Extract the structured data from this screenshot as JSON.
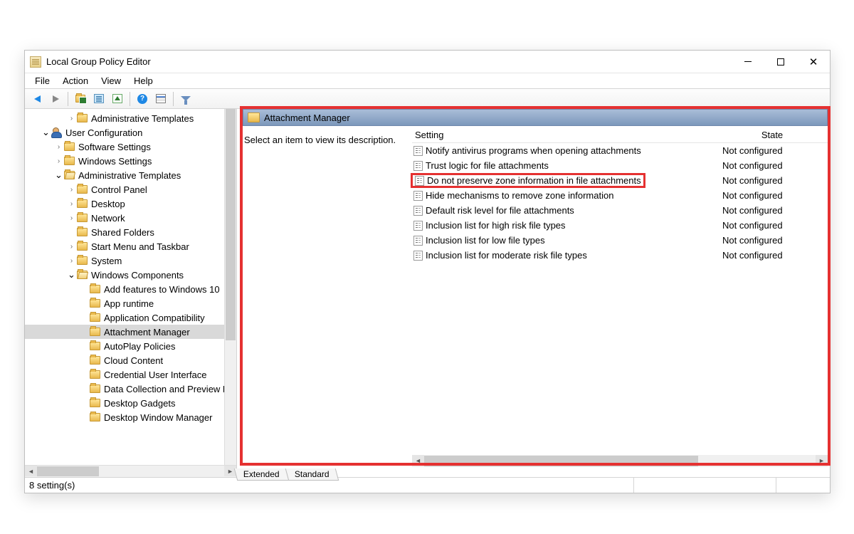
{
  "window": {
    "title": "Local Group Policy Editor"
  },
  "menu": {
    "file": "File",
    "action": "Action",
    "view": "View",
    "help": "Help"
  },
  "tree": {
    "items": [
      {
        "indent": 2,
        "expander": ">",
        "icon": "folder",
        "label": "Administrative Templates"
      },
      {
        "indent": 0,
        "expander": "v",
        "icon": "user",
        "label": "User Configuration"
      },
      {
        "indent": 1,
        "expander": ">",
        "icon": "folder",
        "label": "Software Settings"
      },
      {
        "indent": 1,
        "expander": ">",
        "icon": "folder",
        "label": "Windows Settings"
      },
      {
        "indent": 1,
        "expander": "v",
        "icon": "folder-open",
        "label": "Administrative Templates"
      },
      {
        "indent": 2,
        "expander": ">",
        "icon": "folder",
        "label": "Control Panel"
      },
      {
        "indent": 2,
        "expander": ">",
        "icon": "folder",
        "label": "Desktop"
      },
      {
        "indent": 2,
        "expander": ">",
        "icon": "folder",
        "label": "Network"
      },
      {
        "indent": 2,
        "expander": "",
        "icon": "folder",
        "label": "Shared Folders"
      },
      {
        "indent": 2,
        "expander": ">",
        "icon": "folder",
        "label": "Start Menu and Taskbar"
      },
      {
        "indent": 2,
        "expander": ">",
        "icon": "folder",
        "label": "System"
      },
      {
        "indent": 2,
        "expander": "v",
        "icon": "folder-open",
        "label": "Windows Components"
      },
      {
        "indent": 3,
        "expander": "",
        "icon": "folder",
        "label": "Add features to Windows 10"
      },
      {
        "indent": 3,
        "expander": "",
        "icon": "folder",
        "label": "App runtime"
      },
      {
        "indent": 3,
        "expander": "",
        "icon": "folder",
        "label": "Application Compatibility"
      },
      {
        "indent": 3,
        "expander": "",
        "icon": "folder",
        "label": "Attachment Manager",
        "selected": true
      },
      {
        "indent": 3,
        "expander": "",
        "icon": "folder",
        "label": "AutoPlay Policies"
      },
      {
        "indent": 3,
        "expander": "",
        "icon": "folder",
        "label": "Cloud Content"
      },
      {
        "indent": 3,
        "expander": "",
        "icon": "folder",
        "label": "Credential User Interface"
      },
      {
        "indent": 3,
        "expander": "",
        "icon": "folder",
        "label": "Data Collection and Preview B"
      },
      {
        "indent": 3,
        "expander": "",
        "icon": "folder",
        "label": "Desktop Gadgets"
      },
      {
        "indent": 3,
        "expander": "",
        "icon": "folder",
        "label": "Desktop Window Manager"
      }
    ]
  },
  "right": {
    "header": "Attachment Manager",
    "description": "Select an item to view its description.",
    "columns": {
      "setting": "Setting",
      "state": "State"
    },
    "rows": [
      {
        "label": "Notify antivirus programs when opening attachments",
        "state": "Not configured"
      },
      {
        "label": "Trust logic for file attachments",
        "state": "Not configured"
      },
      {
        "label": "Do not preserve zone information in file attachments",
        "state": "Not configured",
        "marked": true
      },
      {
        "label": "Hide mechanisms to remove zone information",
        "state": "Not configured"
      },
      {
        "label": "Default risk level for file attachments",
        "state": "Not configured"
      },
      {
        "label": "Inclusion list for high risk file types",
        "state": "Not configured"
      },
      {
        "label": "Inclusion list for low file types",
        "state": "Not configured"
      },
      {
        "label": "Inclusion list for moderate risk file types",
        "state": "Not configured"
      }
    ],
    "tabs": {
      "extended": "Extended",
      "standard": "Standard"
    }
  },
  "status": "8 setting(s)"
}
